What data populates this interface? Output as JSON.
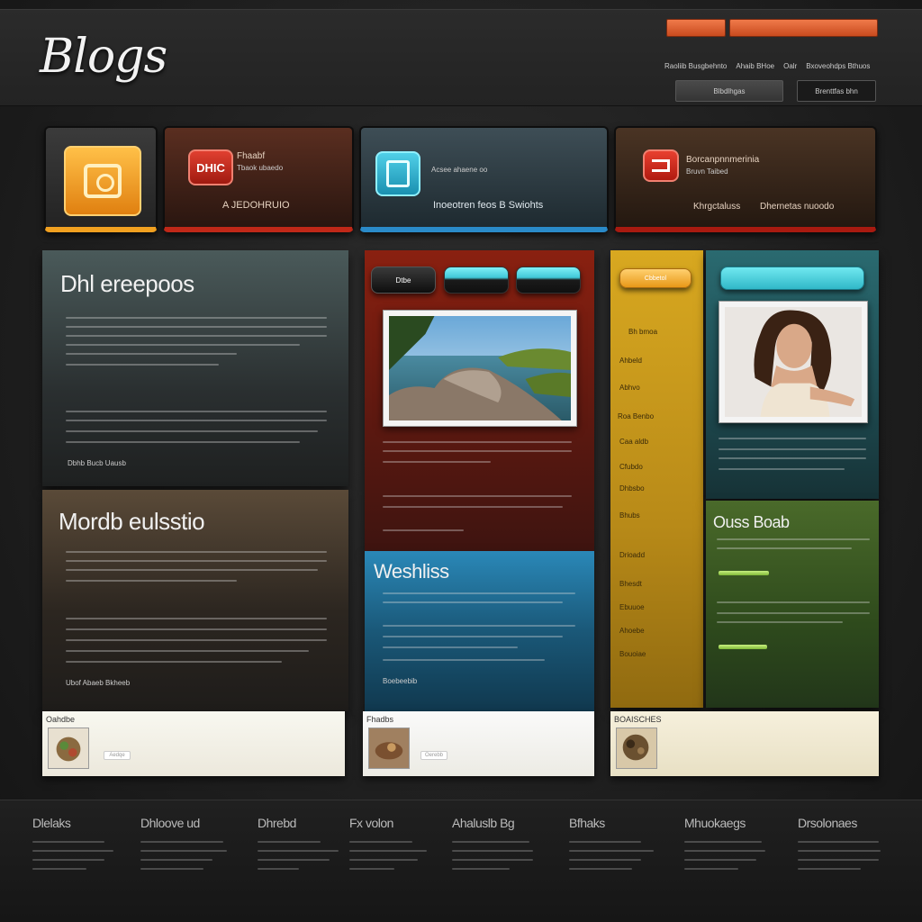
{
  "header": {
    "logo": "Blogs",
    "top_button_a": "",
    "top_button_b": "",
    "nav": [
      "Raoliib Busgbehnto",
      "Ahaib BHoe",
      "Oalr",
      "Bxoveohdps Bthuos"
    ],
    "box_a": "Blbdlhgas",
    "box_b": "Brenttfas bhn"
  },
  "tiles": {
    "t2_title": "Fhaabf",
    "t2_sub": "Tbaok ubaedo",
    "t2_badge": "DHIC",
    "t2_caption": "A JEDOHRUIO",
    "t3_sub": "Acsee ahaene oo",
    "t3_caption": "Inoeotren feos B Swiohts",
    "t4_title": "Borcanpnnmerinia",
    "t4_sub": "Bruvn Taibed",
    "t4_caption_a": "Khrgctaluss",
    "t4_caption_b": "Dhernetas nuoodo"
  },
  "panels": {
    "dark1_title": "Dhl ereepoos",
    "dark1_footer": "Dbhb Bucb Uausb",
    "dark2_title": "Mordb eulsstio",
    "dark2_footer": "Ubof Abaeb Bkheeb",
    "red_pill": "Dtbe",
    "blue_title": "Weshliss",
    "blue_footer": "Boebeebib",
    "yellow_pill": "Cbbetol",
    "yellow_items": [
      "Bh bmoa",
      "Ahbeld",
      "Abhvo",
      "Roa Benbo",
      "Caa aldb",
      "Cfubdo",
      "Dhbsbo",
      "Bhubs",
      "Drioadd",
      "Bhesdt",
      "Ebuuoe",
      "Ahoebe",
      "Bouoiae"
    ],
    "green_title": "Ouss Boab"
  },
  "cards": {
    "c1_title": "Oahdbe",
    "c1_button": "Aedqe",
    "c2_title": "Fhadbs",
    "c2_button": "Oerebb",
    "c3_title": "BOAISCHES"
  },
  "footer": {
    "columns": [
      "Dlelaks",
      "Dhloove ud",
      "Dhrebd",
      "Fx volon",
      "Ahaluslb Bg",
      "Bfhaks",
      "Mhuokaegs",
      "Drsolonaes"
    ]
  },
  "colors": {
    "accent_orange": "#e8602a",
    "tile_yellow": "#f0a020",
    "tile_red": "#c02818",
    "tile_blue": "#2a8ac8",
    "panel_red": "#8a2010",
    "panel_blue": "#1a5878",
    "panel_yellow": "#c89a18",
    "panel_teal": "#2a6a70",
    "panel_green": "#3a5a22"
  },
  "icons": [
    "photo-frame-icon",
    "document-icon",
    "folder-icon",
    "mail-icon"
  ]
}
